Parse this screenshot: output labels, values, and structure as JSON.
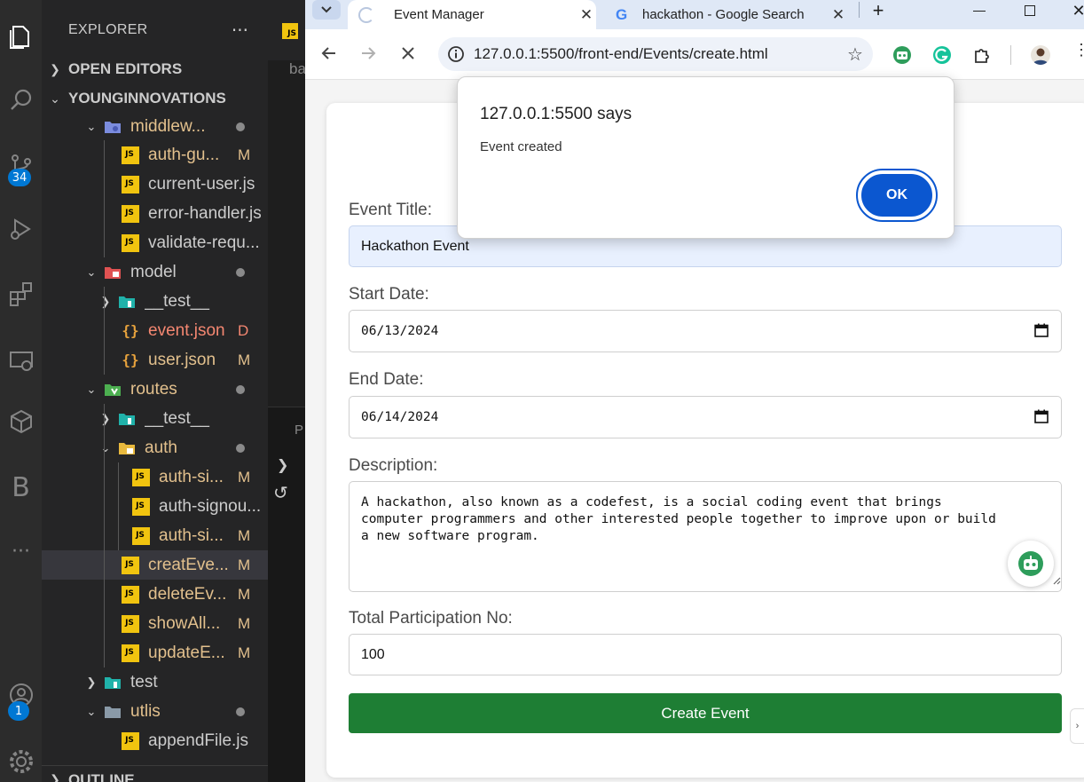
{
  "vscode": {
    "explorer_title": "EXPLORER",
    "more_label": "···",
    "editor_tab_badge": "JS",
    "editor_fragment": "ba",
    "panel_fragment": "P",
    "sections": {
      "open_editors": "OPEN EDITORS",
      "workspace": "YOUNGINNOVATIONS",
      "outline": "OUTLINE"
    },
    "badges": {
      "source_control": "34",
      "accounts": "1"
    },
    "activity_icons": [
      "explorer-icon",
      "search-icon",
      "source-control-icon",
      "run-debug-icon",
      "extensions-icon",
      "remote-explorer-icon",
      "testing-icon",
      "bold-b-icon",
      "more-icon",
      "accounts-icon",
      "settings-gear-icon"
    ],
    "tree": [
      {
        "name": "middlew...",
        "kind": "folder",
        "status": "dot"
      },
      {
        "name": "auth-gu...",
        "kind": "js",
        "status": "M"
      },
      {
        "name": "current-user.js",
        "kind": "js",
        "status": ""
      },
      {
        "name": "error-handler.js",
        "kind": "js",
        "status": ""
      },
      {
        "name": "validate-requ...",
        "kind": "js",
        "status": ""
      },
      {
        "name": "model",
        "kind": "folder",
        "status": "dot"
      },
      {
        "name": "__test__",
        "kind": "folder",
        "status": ""
      },
      {
        "name": "event.json",
        "kind": "json",
        "status": "D"
      },
      {
        "name": "user.json",
        "kind": "json",
        "status": "M"
      },
      {
        "name": "routes",
        "kind": "folder",
        "status": "dot"
      },
      {
        "name": "__test__",
        "kind": "folder",
        "status": ""
      },
      {
        "name": "auth",
        "kind": "folder",
        "status": "dot"
      },
      {
        "name": "auth-si...",
        "kind": "js",
        "status": "M"
      },
      {
        "name": "auth-signou...",
        "kind": "js",
        "status": ""
      },
      {
        "name": "auth-si...",
        "kind": "js",
        "status": "M"
      },
      {
        "name": "creatEve...",
        "kind": "js",
        "status": "M"
      },
      {
        "name": "deleteEv...",
        "kind": "js",
        "status": "M"
      },
      {
        "name": "showAll...",
        "kind": "js",
        "status": "M"
      },
      {
        "name": "updateE...",
        "kind": "js",
        "status": "M"
      },
      {
        "name": "test",
        "kind": "folder",
        "status": ""
      },
      {
        "name": "utlis",
        "kind": "folder",
        "status": "dot"
      },
      {
        "name": "appendFile.js",
        "kind": "js",
        "status": ""
      }
    ]
  },
  "browser": {
    "tabs": [
      {
        "title": "Event Manager",
        "close": "✕"
      },
      {
        "title": "hackathon - Google Search",
        "close": "✕"
      }
    ],
    "new_tab": "+",
    "url": "127.0.0.1:5500/front-end/Events/create.html",
    "icons": [
      "tab-search-icon",
      "back-icon",
      "forward-icon",
      "stop-icon",
      "site-info-icon",
      "bookmark-star-icon",
      "bot-extension-icon",
      "grammarly-icon",
      "extensions-puzzle-icon",
      "profile-avatar-icon",
      "kebab-menu-icon"
    ]
  },
  "form": {
    "title_label": "Event Title:",
    "title_value": "Hackathon Event",
    "start_label": "Start Date:",
    "start_value": "06/13/2024",
    "end_label": "End Date:",
    "end_value": "06/14/2024",
    "desc_label": "Description:",
    "desc_value": "A hackathon, also known as a codefest, is a social coding event that brings computer programmers and other interested people together to improve upon or build a new software program.",
    "participants_label": "Total Participation No:",
    "participants_value": "100",
    "submit_label": "Create Event"
  },
  "dialog": {
    "title": "127.0.0.1:5500 says",
    "message": "Event created",
    "ok_label": "OK"
  }
}
